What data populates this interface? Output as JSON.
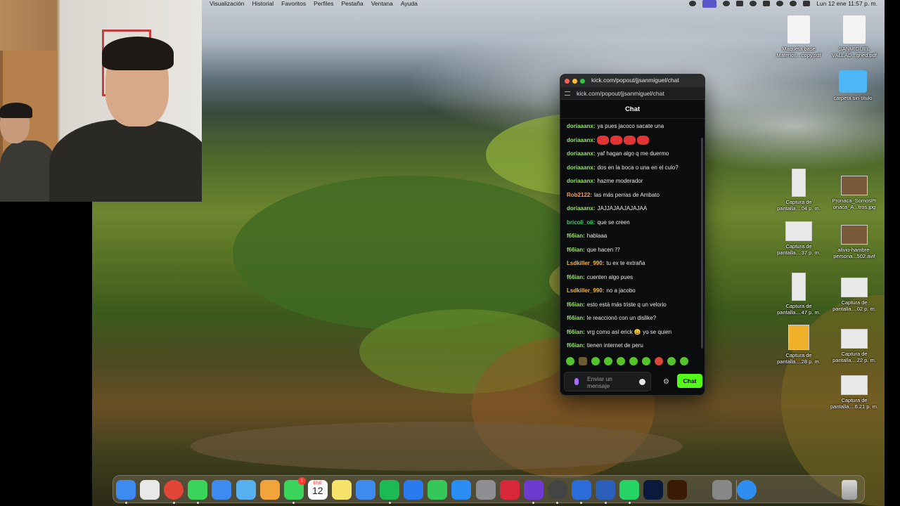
{
  "menubar": {
    "items": [
      "Visualización",
      "Historial",
      "Favoritos",
      "Perfiles",
      "Pestaña",
      "Ventana",
      "Ayuda"
    ],
    "clock": "Lun 12 ene  11:57 p. m."
  },
  "chat_window": {
    "title": "kick.com/popout/jjsanmiguel/chat",
    "url": "kick.com/popout/jjsanmiguel/chat",
    "header": "Chat",
    "messages": [
      {
        "user": "doriaaanx:",
        "text": "ya pues jacoco sacate una",
        "color": "#9be36b"
      },
      {
        "user": "doriaaanx:",
        "text": "",
        "color": "#9be36b",
        "emojis": 4
      },
      {
        "user": "doriaaanx:",
        "text": "yaf hagan algo q me duermo",
        "color": "#9be36b"
      },
      {
        "user": "doriaaanx:",
        "text": "dos en la boca o una en el culo?",
        "color": "#9be36b"
      },
      {
        "user": "doriaaanx:",
        "text": "hazme moderador",
        "color": "#9be36b"
      },
      {
        "user": "Rob2122:",
        "text": "las más perras de Ambato",
        "color": "#f2a05a"
      },
      {
        "user": "doriaaanx:",
        "text": "JAJJAJAAJAJAJAA",
        "color": "#9be36b"
      },
      {
        "user": "bricoli_oli:",
        "text": "que se creen",
        "color": "#3ecf6e"
      },
      {
        "user": "f66ian:",
        "text": "hablaaa",
        "color": "#9be36b"
      },
      {
        "user": "f66ian:",
        "text": "que hacen ⁇",
        "color": "#9be36b"
      },
      {
        "user": "Lsdkiller_990:",
        "text": "tu ex te extraña",
        "color": "#f2b84a"
      },
      {
        "user": "f66ian:",
        "text": "cuenten algo pues",
        "color": "#9be36b"
      },
      {
        "user": "Lsdkiller_990:",
        "text": "no a jacobo",
        "color": "#f2b84a"
      },
      {
        "user": "f66ian:",
        "text": "esto está más triste q un velorio",
        "color": "#9be36b"
      },
      {
        "user": "f66ian:",
        "text": "le reaccionó con un dislike?",
        "color": "#9be36b"
      },
      {
        "user": "f66ian:",
        "text": "vrg como así erick 😀 yo se quien",
        "color": "#9be36b"
      },
      {
        "user": "f66ian:",
        "text": "tienen internet de peru",
        "color": "#9be36b"
      }
    ],
    "input_placeholder": "Enviar un mensaje",
    "send_label": "Chat",
    "accent": "#53fc18"
  },
  "desktop_icons": [
    {
      "label": "Maqueta base Materiot....copy.pdf",
      "kind": "doc"
    },
    {
      "label": "SANMIGUEL VALLAD...gned.pdf",
      "kind": "doc"
    },
    {
      "label": "carpeta sin título",
      "kind": "folder"
    },
    {
      "label": "Captura de pantalla....04 p. m.",
      "kind": "tall"
    },
    {
      "label": "Pronaca_SomosPr onaca_A...tros.jpg",
      "kind": "photo"
    },
    {
      "label": "Captura de pantalla....37 p. m.",
      "kind": "shot"
    },
    {
      "label": "alivio-hambre-persona...502.avif",
      "kind": "photo"
    },
    {
      "label": "Captura de pantalla....47 p. m.",
      "kind": "tall"
    },
    {
      "label": "Captura de pantalla....02 p. m.",
      "kind": "shot"
    },
    {
      "label": "Captura de pantalla....28 p. m.",
      "kind": "promo"
    },
    {
      "label": "Captura de pantalla....22 p. m.",
      "kind": "shot"
    },
    {
      "label": "Captura de pantalla....6.21 p. m.",
      "kind": "shot"
    }
  ],
  "dock": {
    "calendar": {
      "month": "ENE",
      "day": "12"
    },
    "badge": "1",
    "apps": [
      "finder-icon",
      "launchpad-icon",
      "chrome-icon",
      "messages-icon",
      "mail-icon",
      "maps-icon",
      "photos-icon",
      "facetime-icon",
      "calendar-icon",
      "notes-icon",
      "freeform-icon",
      "spotify-icon",
      "keynote-icon",
      "numbers-icon",
      "app-store-icon",
      "system-settings-icon",
      "filmora-icon",
      "visual-studio-icon",
      "obs-icon",
      "kick-icon",
      "word-icon",
      "whatsapp-icon",
      "photoshop-icon",
      "illustrator-icon",
      "finder-window-icon",
      "folder-icon"
    ]
  }
}
